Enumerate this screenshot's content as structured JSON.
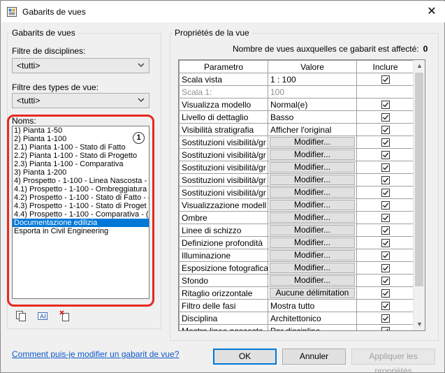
{
  "window": {
    "title": "Gabarits de vues",
    "close_glyph": "✕",
    "icon": "revit-view-icon"
  },
  "left": {
    "group_label": "Gabarits de vues",
    "discipline_filter_label": "Filtre de disciplines:",
    "discipline_filter_value": "<tutti>",
    "viewtype_filter_label": "Filtre des types de vue:",
    "viewtype_filter_value": "<tutti>",
    "names_label": "Noms:",
    "callout_number": "1",
    "names": [
      "1) Pianta 1-50",
      "2) Pianta 1-100",
      "2.1) Pianta 1-100 - Stato di Fatto",
      "2.2) Pianta 1-100 - Stato di Progetto",
      "2.3) Pianta 1-100 - Comparativa",
      "3) Pianta 1-200",
      "4) Prospetto - 1-100 - Linea Nascosta - (",
      "4.1) Prospetto - 1-100 - Ombreggiatura",
      "4.2) Prospetto - 1-100 - Stato di Fatto - (",
      "4.3) Prospetto - 1-100 - Stato di Proget",
      "4.4) Prospetto - 1-100 - Comparativa - (",
      "Documentazione edilizia",
      "Esporta in Civil Engineering"
    ],
    "selected_index": 11,
    "tool_icons": [
      "duplicate-icon",
      "rename-icon",
      "delete-icon"
    ]
  },
  "right": {
    "group_label": "Propriétés de la vue",
    "count_label": "Nombre de vues auxquelles ce gabarit est affecté:",
    "count_value": "0",
    "columns": [
      "Parametro",
      "Valore",
      "Inclure"
    ],
    "rows": [
      {
        "param": "Scala vista",
        "value": "1 : 100",
        "kind": "text",
        "include": true,
        "enabled": true
      },
      {
        "param": "Scala  1:",
        "value": "100",
        "kind": "text",
        "include": null,
        "enabled": false
      },
      {
        "param": "Visualizza modello",
        "value": "Normal(e)",
        "kind": "text",
        "include": true,
        "enabled": true
      },
      {
        "param": "Livello di dettaglio",
        "value": "Basso",
        "kind": "text",
        "include": true,
        "enabled": true
      },
      {
        "param": "Visibilità stratigrafia",
        "value": "Afficher l'original",
        "kind": "text",
        "include": true,
        "enabled": true
      },
      {
        "param": "Sostituzioni visibilità/gr",
        "value": "Modifier...",
        "kind": "button",
        "include": true,
        "enabled": true
      },
      {
        "param": "Sostituzioni visibilità/gr",
        "value": "Modifier...",
        "kind": "button",
        "include": true,
        "enabled": true
      },
      {
        "param": "Sostituzioni visibilità/gr",
        "value": "Modifier...",
        "kind": "button",
        "include": true,
        "enabled": true
      },
      {
        "param": "Sostituzioni visibilità/gr",
        "value": "Modifier...",
        "kind": "button",
        "include": true,
        "enabled": true
      },
      {
        "param": "Sostituzioni visibilità/gr",
        "value": "Modifier...",
        "kind": "button",
        "include": true,
        "enabled": true
      },
      {
        "param": "Visualizzazione modell",
        "value": "Modifier...",
        "kind": "button",
        "include": true,
        "enabled": true
      },
      {
        "param": "Ombre",
        "value": "Modifier...",
        "kind": "button",
        "include": true,
        "enabled": true
      },
      {
        "param": "Linee di schizzo",
        "value": "Modifier...",
        "kind": "button",
        "include": true,
        "enabled": true
      },
      {
        "param": "Definizione profondità",
        "value": "Modifier...",
        "kind": "button",
        "include": true,
        "enabled": true
      },
      {
        "param": "Illuminazione",
        "value": "Modifier...",
        "kind": "button",
        "include": true,
        "enabled": true
      },
      {
        "param": "Esposizione fotografica",
        "value": "Modifier...",
        "kind": "button",
        "include": true,
        "enabled": true
      },
      {
        "param": "Sfondo",
        "value": "Modifier...",
        "kind": "button",
        "include": true,
        "enabled": true
      },
      {
        "param": "Ritaglio orizzontale",
        "value": "Aucune délimitation",
        "kind": "button",
        "include": true,
        "enabled": true
      },
      {
        "param": "Filtro delle fasi",
        "value": "Mostra tutto",
        "kind": "text",
        "include": true,
        "enabled": true
      },
      {
        "param": "Disciplina",
        "value": "Architettonico",
        "kind": "text",
        "include": true,
        "enabled": true
      },
      {
        "param": "Mostra linee nascoste",
        "value": "Par discipline",
        "kind": "text",
        "include": true,
        "enabled": true
      }
    ]
  },
  "footer": {
    "help_link": "Comment puis-je modifier un gabarit de vue?",
    "ok": "OK",
    "cancel": "Annuler",
    "apply": "Appliquer les propriétés"
  }
}
